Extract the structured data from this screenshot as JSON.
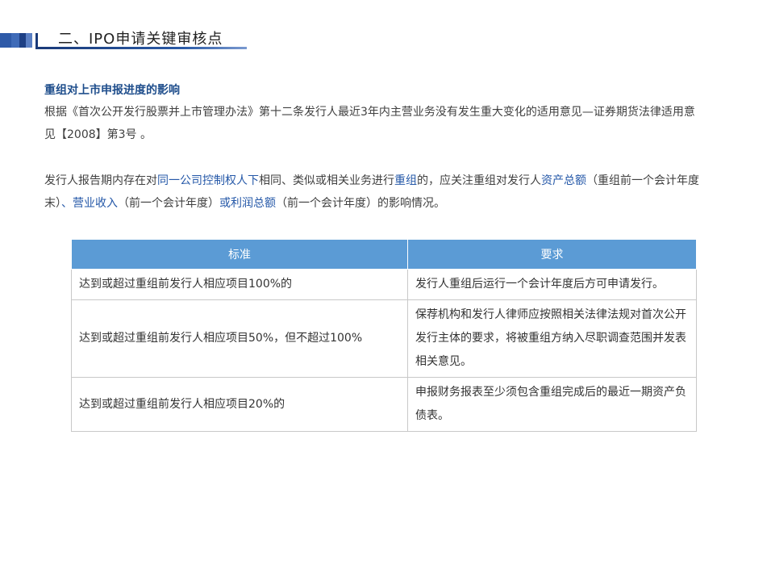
{
  "header": {
    "title": "二、IPO申请关键审核点"
  },
  "section": {
    "heading": "重组对上市申报进度的影响",
    "para1": "根据《首次公开发行股票并上市管理办法》第十二条发行人最近3年内主营业务没有发生重大变化的适用意见—证券期货法律适用意见【2008】第3号 。",
    "para2": {
      "t1": "发行人报告期内存在对",
      "h1": "同一公司控制权人下",
      "t2": "相同、类似或相关业务进行",
      "h2": "重组",
      "t3": "的，应关注重组对发行人",
      "h3": "资产总额",
      "t4": "（重组前一个会计年度末）",
      "h4": "、营业收入",
      "t5": "（前一个会计年度）",
      "h5": "或利润总额",
      "t6": "（前一个会计年度）的影响情况。"
    }
  },
  "table": {
    "headers": [
      "标准",
      "要求"
    ],
    "rows": [
      [
        "达到或超过重组前发行人相应项目100%的",
        "发行人重组后运行一个会计年度后方可申请发行。"
      ],
      [
        "达到或超过重组前发行人相应项目50%，但不超过100%",
        "保荐机构和发行人律师应按照相关法律法规对首次公开发行主体的要求，将被重组方纳入尽职调查范围并发表相关意见。"
      ],
      [
        "达到或超过重组前发行人相应项目20%的",
        "申报财务报表至少须包含重组完成后的最近一期资产负债表。"
      ]
    ]
  },
  "colors": {
    "accent": "#1f4e8c",
    "highlight": "#2558a8",
    "table_header": "#5b9bd5"
  }
}
